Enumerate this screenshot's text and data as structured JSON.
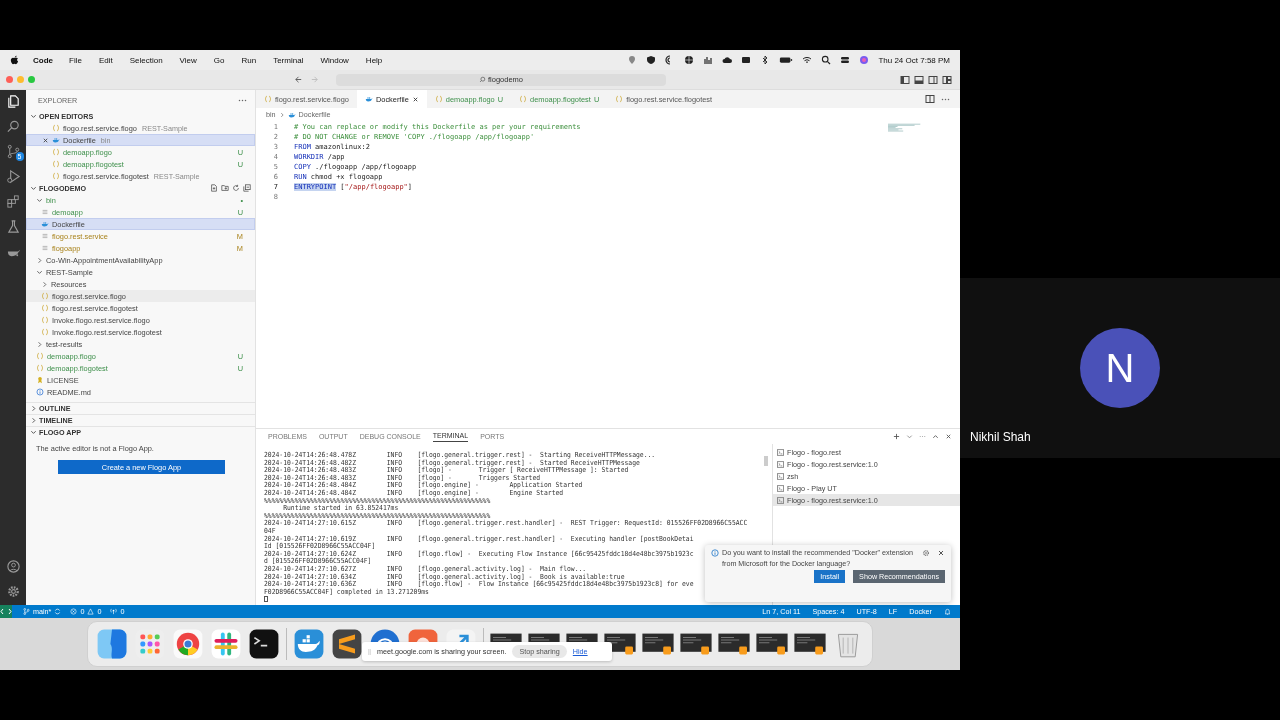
{
  "menu_bar": {
    "app": "Code",
    "items": [
      "File",
      "Edit",
      "Selection",
      "View",
      "Go",
      "Run",
      "Terminal",
      "Window",
      "Help"
    ],
    "clock": "Thu 24 Oct  7:58 PM"
  },
  "title_bar": {
    "search": "flogodemo"
  },
  "activity_bar": {
    "badge": "5"
  },
  "sidebar": {
    "title": "EXPLORER",
    "open_editors": {
      "title": "OPEN EDITORS",
      "items": [
        {
          "name": "flogo.rest.service.flogo",
          "detail": "REST-Sample",
          "kind": "json",
          "untracked": false,
          "modified": false,
          "selected": false
        },
        {
          "name": "Dockerfile",
          "detail": "bin",
          "kind": "docker",
          "untracked": false,
          "modified": false,
          "selected": true
        },
        {
          "name": "demoapp.flogo",
          "status": "U",
          "kind": "json",
          "untracked": true,
          "modified": false,
          "selected": false
        },
        {
          "name": "demoapp.flogotest",
          "status": "U",
          "kind": "json",
          "untracked": true,
          "modified": false,
          "selected": false
        },
        {
          "name": "flogo.rest.service.flogotest",
          "detail": "REST-Sample",
          "kind": "json",
          "untracked": false,
          "modified": false,
          "selected": false
        }
      ]
    },
    "project": {
      "title": "FLOGODEMO",
      "tree": [
        {
          "name": "bin",
          "kind": "folder",
          "expanded": true,
          "untracked": true,
          "modified": false,
          "status": "•",
          "selected": false,
          "hovered": false,
          "children": [
            {
              "name": "demoapp",
              "kind": "file",
              "untracked": true,
              "modified": false,
              "status": "U",
              "selected": false,
              "hovered": false
            },
            {
              "name": "Dockerfile",
              "kind": "docker",
              "untracked": false,
              "modified": false,
              "selected": true,
              "hovered": false
            },
            {
              "name": "flogo.rest.service",
              "kind": "file",
              "untracked": false,
              "modified": true,
              "status": "M",
              "selected": false,
              "hovered": false
            },
            {
              "name": "flogoapp",
              "kind": "file",
              "untracked": false,
              "modified": true,
              "status": "M",
              "selected": false,
              "hovered": false
            }
          ]
        },
        {
          "name": "Co-Win-AppointmentAvailabilityApp",
          "kind": "folder",
          "expanded": false,
          "untracked": false,
          "modified": false,
          "selected": false,
          "hovered": false
        },
        {
          "name": "REST-Sample",
          "kind": "folder",
          "expanded": true,
          "untracked": false,
          "modified": false,
          "selected": false,
          "hovered": false,
          "children": [
            {
              "name": "Resources",
              "kind": "folder",
              "expanded": false,
              "untracked": false,
              "modified": false,
              "selected": false,
              "hovered": false
            },
            {
              "name": "flogo.rest.service.flogo",
              "kind": "json",
              "untracked": false,
              "modified": false,
              "selected": false,
              "hovered": true
            },
            {
              "name": "flogo.rest.service.flogotest",
              "kind": "json",
              "untracked": false,
              "modified": false,
              "selected": false,
              "hovered": false
            },
            {
              "name": "Invoke.flogo.rest.service.flogo",
              "kind": "json",
              "untracked": false,
              "modified": false,
              "selected": false,
              "hovered": false
            },
            {
              "name": "Invoke.flogo.rest.service.flogotest",
              "kind": "json",
              "untracked": false,
              "modified": false,
              "selected": false,
              "hovered": false
            }
          ]
        },
        {
          "name": "test-results",
          "kind": "folder",
          "expanded": false,
          "untracked": false,
          "modified": false,
          "selected": false,
          "hovered": false
        },
        {
          "name": "demoapp.flogo",
          "kind": "json",
          "untracked": true,
          "modified": false,
          "status": "U",
          "selected": false,
          "hovered": false
        },
        {
          "name": "demoapp.flogotest",
          "kind": "json",
          "untracked": true,
          "modified": false,
          "status": "U",
          "selected": false,
          "hovered": false
        },
        {
          "name": "LICENSE",
          "kind": "license",
          "untracked": false,
          "modified": false,
          "selected": false,
          "hovered": false
        },
        {
          "name": "README.md",
          "kind": "info",
          "untracked": false,
          "modified": false,
          "selected": false,
          "hovered": false
        }
      ]
    },
    "sections": [
      {
        "title": "OUTLINE",
        "expanded": false
      },
      {
        "title": "TIMELINE",
        "expanded": false
      },
      {
        "title": "FLOGO APP",
        "expanded": true
      }
    ],
    "flogo_app": {
      "message": "The active editor is not a Flogo App.",
      "button": "Create a new Flogo App"
    }
  },
  "editor": {
    "tabs": [
      {
        "label": "flogo.rest.service.flogo",
        "kind": "json",
        "untracked": false,
        "selected": false
      },
      {
        "label": "Dockerfile",
        "kind": "docker",
        "untracked": false,
        "selected": true
      },
      {
        "label": "demoapp.flogo",
        "status": "U",
        "kind": "json",
        "untracked": true,
        "selected": false
      },
      {
        "label": "demoapp.flogotest",
        "status": "U",
        "kind": "json",
        "untracked": true,
        "selected": false
      },
      {
        "label": "flogo.rest.service.flogotest",
        "kind": "json",
        "untracked": false,
        "selected": false
      }
    ],
    "breadcrumb": [
      "bin",
      "Dockerfile"
    ],
    "lines": [
      {
        "number": "1",
        "current": false,
        "tokens": [
          {
            "text": "# You can replace or modify this Dockerfile as per your requirements",
            "kind": "comment"
          }
        ]
      },
      {
        "number": "2",
        "current": false,
        "tokens": [
          {
            "text": "# DO NOT CHANGE or REMOVE 'COPY ./flogoapp /app/flogoapp'",
            "kind": "comment"
          }
        ]
      },
      {
        "number": "3",
        "current": false,
        "tokens": [
          {
            "text": "FROM",
            "kind": "keyword"
          },
          {
            "text": " amazonlinux:2",
            "kind": "plain"
          }
        ]
      },
      {
        "number": "4",
        "current": false,
        "tokens": [
          {
            "text": "WORKDIR",
            "kind": "keyword"
          },
          {
            "text": " /app",
            "kind": "plain"
          }
        ]
      },
      {
        "number": "5",
        "current": false,
        "tokens": [
          {
            "text": "COPY",
            "kind": "keyword"
          },
          {
            "text": " ./flogoapp /app/flogoapp",
            "kind": "plain"
          }
        ]
      },
      {
        "number": "6",
        "current": false,
        "tokens": [
          {
            "text": "RUN",
            "kind": "keyword"
          },
          {
            "text": " chmod +x flogoapp",
            "kind": "plain"
          }
        ]
      },
      {
        "number": "7",
        "current": true,
        "tokens": [
          {
            "text": "ENTRYPOINT",
            "kind": "keyword",
            "highlighted": true
          },
          {
            "text": " [",
            "kind": "plain"
          },
          {
            "text": "\"/app/flogoapp\"",
            "kind": "string"
          },
          {
            "text": "]",
            "kind": "plain"
          }
        ]
      },
      {
        "number": "8",
        "current": false
      }
    ]
  },
  "panel": {
    "tabs": [
      {
        "label": "PROBLEMS",
        "selected": false
      },
      {
        "label": "OUTPUT",
        "selected": false
      },
      {
        "label": "DEBUG CONSOLE",
        "selected": false
      },
      {
        "label": "TERMINAL",
        "selected": true
      },
      {
        "label": "PORTS",
        "selected": false
      }
    ],
    "terminal_lines": [
      "2024-10-24T14:26:48.478Z        INFO    [flogo.general.trigger.rest] -  Starting ReceiveHTTPMessage...",
      "2024-10-24T14:26:48.482Z        INFO    [flogo.general.trigger.rest] -  Started ReceiveHTTPMessage",
      "2024-10-24T14:26:48.483Z        INFO    [flogo] -       Trigger [ ReceiveHTTPMessage ]: Started",
      "2024-10-24T14:26:48.483Z        INFO    [flogo] -       Triggers Started",
      "2024-10-24T14:26:48.484Z        INFO    [flogo.engine] -        Application Started",
      "2024-10-24T14:26:48.484Z        INFO    [flogo.engine] -        Engine Started",
      "%%%%%%%%%%%%%%%%%%%%%%%%%%%%%%%%%%%%%%%%%%%%%%%%%%%%%%%%%%%",
      "     Runtime started in 63.852417ms",
      "%%%%%%%%%%%%%%%%%%%%%%%%%%%%%%%%%%%%%%%%%%%%%%%%%%%%%%%%%%%",
      "2024-10-24T14:27:10.615Z        INFO    [flogo.general.trigger.rest.handler] -  REST Trigger: RequestId: 015526FF02D8966C55ACC",
      "04F",
      "2024-10-24T14:27:10.619Z        INFO    [flogo.general.trigger.rest.handler] -  Executing handler [postBookDetai",
      "Id [015526FF02D8966C55ACC04F]",
      "2024-10-24T14:27:10.624Z        INFO    [flogo.flow] -  Executing Flow Instance [66c95425fddc18d4e48bc3975b1923c",
      "d [015526FF02D8966C55ACC04F]",
      "2024-10-24T14:27:10.627Z        INFO    [flogo.general.activity.log] -  Main flow...",
      "2024-10-24T14:27:10.634Z        INFO    [flogo.general.activity.log] -  Book is available:true",
      "2024-10-24T14:27:10.636Z        INFO    [flogo.flow] -  Flow Instance [66c95425fddc18d4e48bc3975b1923c8] for eve",
      "F02D8966C55ACC04F] completed in 13.271209ms"
    ],
    "terminals": [
      {
        "name": "Flogo - flogo.rest",
        "selected": false
      },
      {
        "name": "Flogo - flogo.rest.service:1.0",
        "selected": false
      },
      {
        "name": "zsh",
        "selected": false
      },
      {
        "name": "Flogo - Play UT",
        "selected": false
      },
      {
        "name": "Flogo - flogo.rest.service:1.0",
        "selected": true
      }
    ]
  },
  "notification": {
    "message": "Do you want to install the recommended \"Docker\" extension from Microsoft for the Docker language?",
    "buttons": [
      "Install",
      "Show Recommendations"
    ]
  },
  "status_bar": {
    "branch": "main*",
    "errors": "0",
    "warnings": "0",
    "ports": "0",
    "right": [
      "Ln 7, Col 11",
      "Spaces: 4",
      "UTF-8",
      "LF",
      "Docker"
    ]
  },
  "screen_share": {
    "message": "meet.google.com is sharing your screen.",
    "stop": "Stop sharing",
    "hide": "Hide"
  },
  "participant": {
    "initial": "N",
    "name": "Nikhil Shah"
  }
}
